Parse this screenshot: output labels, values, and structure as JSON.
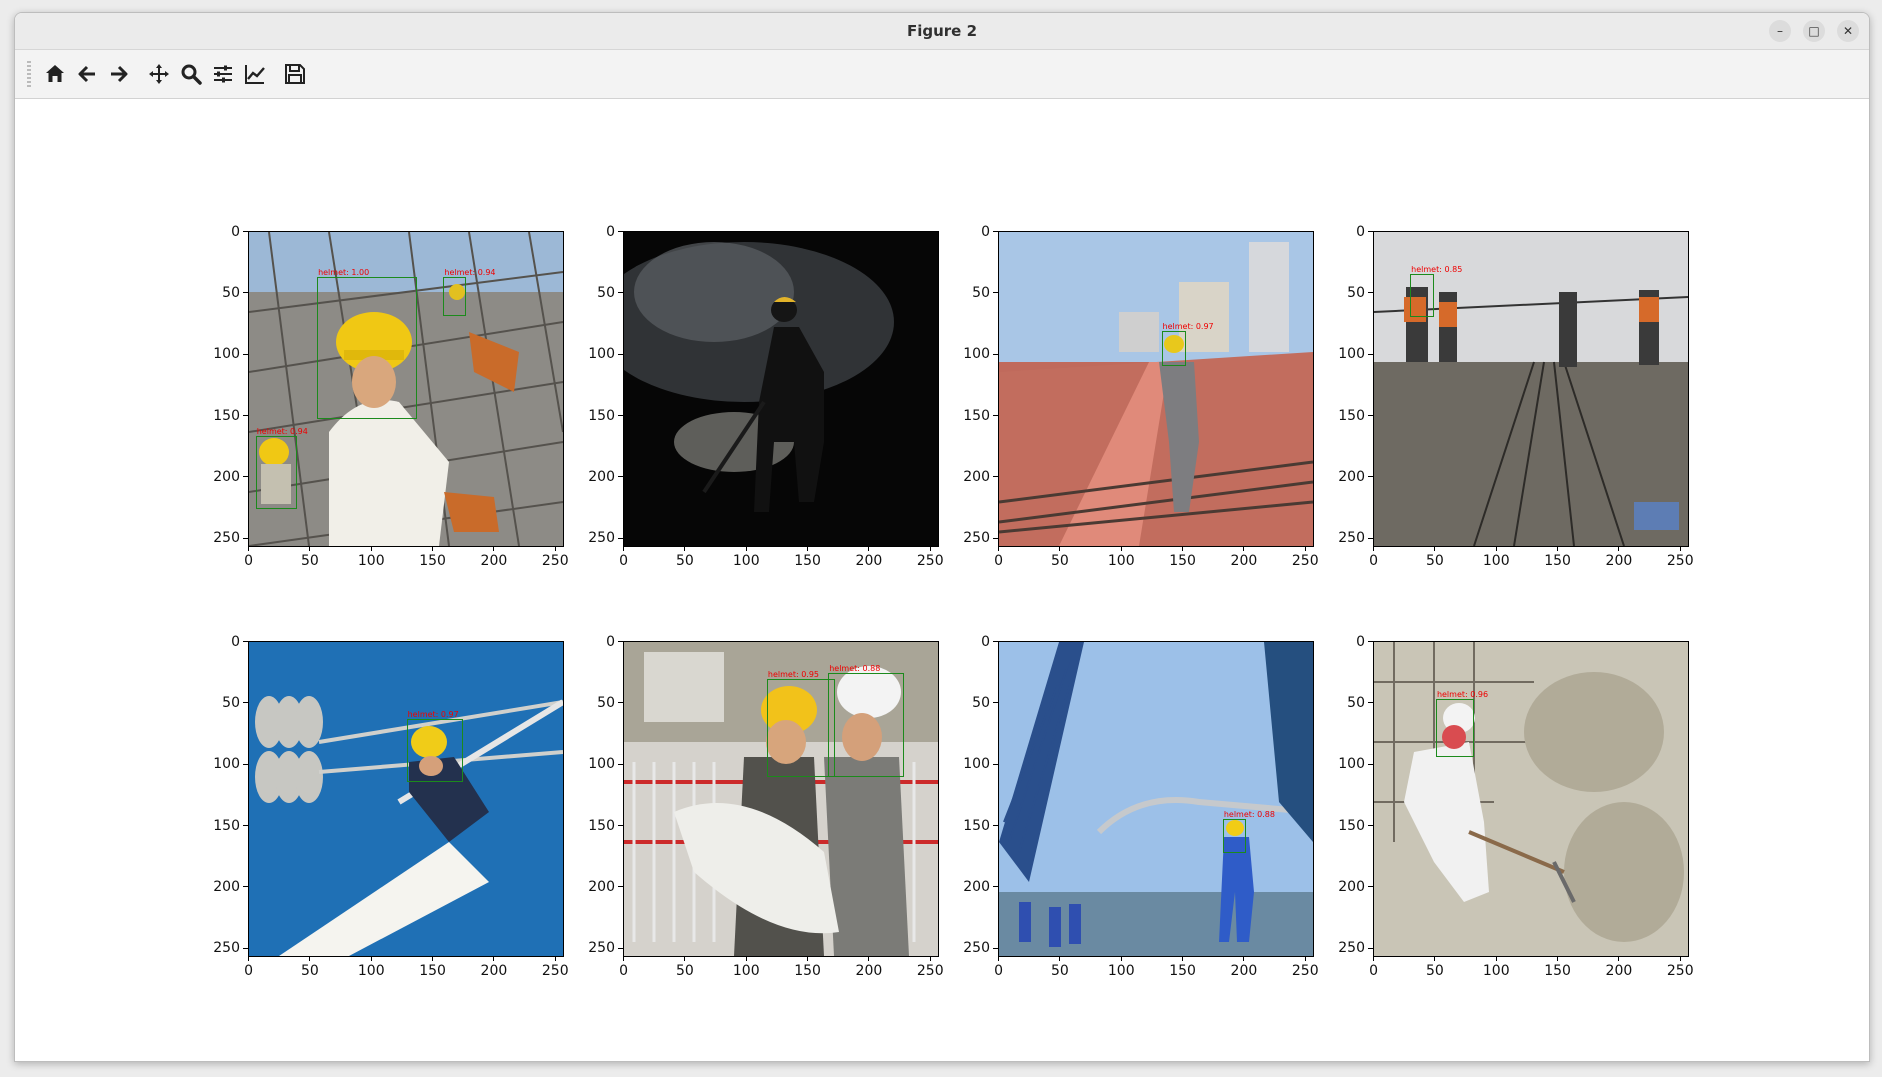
{
  "window": {
    "title": "Figure 2",
    "minimize": "–",
    "maximize": "□",
    "close": "✕"
  },
  "toolbar": [
    {
      "name": "home-icon",
      "tooltip": "Home"
    },
    {
      "name": "back-icon",
      "tooltip": "Back"
    },
    {
      "name": "forward-icon",
      "tooltip": "Forward"
    },
    {
      "name": "pan-icon",
      "tooltip": "Pan"
    },
    {
      "name": "zoom-icon",
      "tooltip": "Zoom"
    },
    {
      "name": "subplots-icon",
      "tooltip": "Configure subplots"
    },
    {
      "name": "edit-axes-icon",
      "tooltip": "Edit axis"
    },
    {
      "name": "save-icon",
      "tooltip": "Save"
    }
  ],
  "axes": {
    "xticks": [
      "0",
      "50",
      "100",
      "150",
      "200",
      "250"
    ],
    "yticks": [
      "0",
      "50",
      "100",
      "150",
      "200",
      "250"
    ]
  },
  "panels": [
    {
      "scene": "rebar-site",
      "detections": [
        {
          "label": "helmet: 1.00",
          "box": [
            55,
            36,
            135,
            150
          ]
        },
        {
          "label": "helmet: 0.94",
          "box": [
            158,
            36,
            175,
            66
          ]
        },
        {
          "label": "helmet: 0.94",
          "box": [
            5,
            166,
            37,
            224
          ]
        }
      ]
    },
    {
      "scene": "dark-silhouette",
      "detections": []
    },
    {
      "scene": "bridge-deck",
      "detections": [
        {
          "label": "helmet: 0.97",
          "box": [
            132,
            80,
            150,
            107
          ]
        }
      ]
    },
    {
      "scene": "railway",
      "detections": [
        {
          "label": "helmet: 0.85",
          "box": [
            29,
            34,
            47,
            67
          ]
        }
      ]
    },
    {
      "scene": "power-line",
      "detections": [
        {
          "label": "helmet: 0.97",
          "box": [
            128,
            62,
            172,
            112
          ]
        }
      ]
    },
    {
      "scene": "two-engineers",
      "detections": [
        {
          "label": "helmet: 0.95",
          "box": [
            116,
            30,
            170,
            108
          ]
        },
        {
          "label": "helmet: 0.88",
          "box": [
            166,
            25,
            226,
            108
          ]
        }
      ]
    },
    {
      "scene": "crane",
      "detections": [
        {
          "label": "helmet: 0.88",
          "box": [
            182,
            144,
            199,
            170
          ]
        }
      ]
    },
    {
      "scene": "wall-plaster",
      "detections": [
        {
          "label": "helmet: 0.96",
          "box": [
            50,
            46,
            79,
            92
          ]
        }
      ]
    }
  ]
}
